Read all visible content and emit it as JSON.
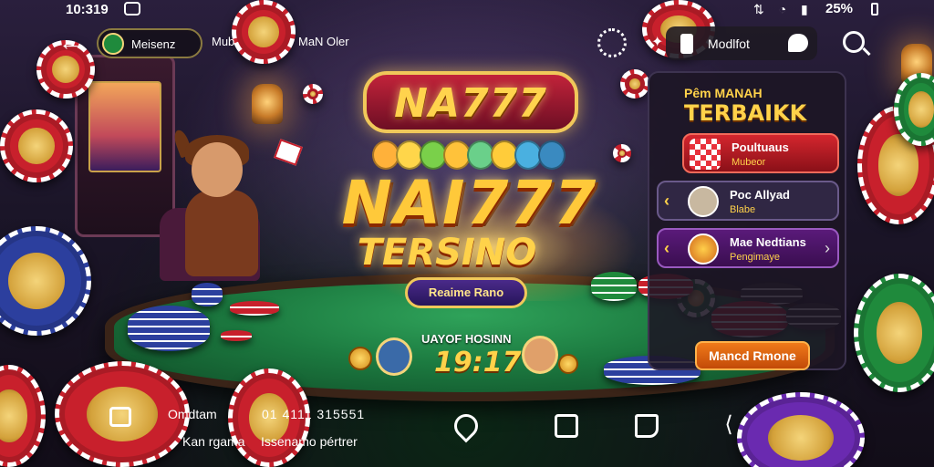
{
  "status_bar": {
    "time": "10:319",
    "signal_icons": "⇅ ◔ ▮",
    "battery_text": "25%"
  },
  "nav": {
    "back_icon": "←",
    "account_label": "Meisenz",
    "text_1": "Mub",
    "text_2": "MaN Oler",
    "pill_label": "Modlfot",
    "pin_icon": "✦"
  },
  "logo": {
    "top": "NA777",
    "main": "NAI777",
    "sub": "TERSINO",
    "cta": "Reaime Rano"
  },
  "jackpot": {
    "label": "UAYOF HOSINN",
    "value": "19:17"
  },
  "side_panel": {
    "title": "Pêm MANAH",
    "heading": "TERBAIKK",
    "cards": [
      {
        "title": "Poultuaus",
        "subtitle": "Mubeor",
        "style": "red"
      },
      {
        "title": "Poc Allyad",
        "subtitle": "Blabe",
        "style": "dark"
      },
      {
        "title": "Mae Nedtians",
        "subtitle": "Pengimaye",
        "style": "purple"
      }
    ],
    "button_label": "Mancd Rmone"
  },
  "bottom": {
    "text_1": "Omdtam",
    "text_2": "01 4111 315551",
    "text_3": "Kan rgama",
    "text_4": "Issenamo pértrer",
    "share_icon": "⟨"
  },
  "colors": {
    "gold": "#ffd24a",
    "felt": "#1c7a40",
    "panel": "#1c1624",
    "accent_red": "#c8202c",
    "accent_orange": "#f07a1a"
  }
}
